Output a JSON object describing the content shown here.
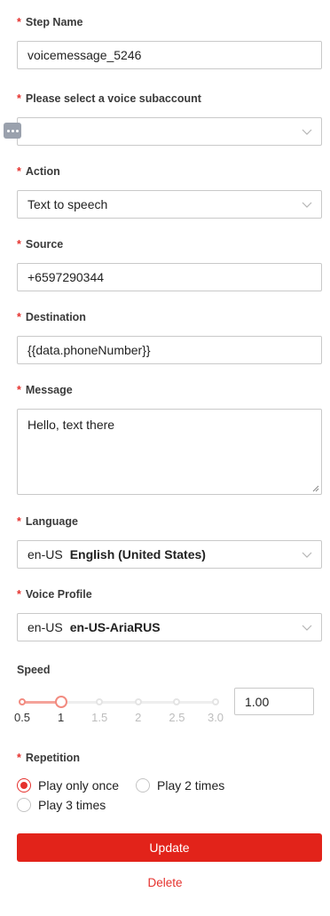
{
  "step_name": {
    "label": "Step Name",
    "value": "voicemessage_5246"
  },
  "voice_subaccount": {
    "label": "Please select a voice subaccount",
    "value": ""
  },
  "action": {
    "label": "Action",
    "value": "Text to speech"
  },
  "source": {
    "label": "Source",
    "value": "+6597290344"
  },
  "destination": {
    "label": "Destination",
    "value": "{{data.phoneNumber}}"
  },
  "message": {
    "label": "Message",
    "value": "Hello, text there"
  },
  "language": {
    "label": "Language",
    "code": "en-US",
    "name": "English (United States)"
  },
  "voice_profile": {
    "label": "Voice Profile",
    "code": "en-US",
    "name": "en-US-AriaRUS"
  },
  "speed": {
    "label": "Speed",
    "value": "1.00",
    "marks": [
      "0.5",
      "1",
      "1.5",
      "2",
      "2.5",
      "3.0"
    ],
    "selected": "1"
  },
  "repetition": {
    "label": "Repetition",
    "options": [
      "Play only once",
      "Play 2 times",
      "Play 3 times"
    ],
    "selected": "Play only once"
  },
  "buttons": {
    "update": "Update",
    "delete": "Delete"
  },
  "colors": {
    "accent": "#e2231a",
    "slider_fill": "#f5a39a"
  },
  "icons": {
    "dropdown": "chevron-down-icon",
    "more": "more-dots-icon"
  }
}
